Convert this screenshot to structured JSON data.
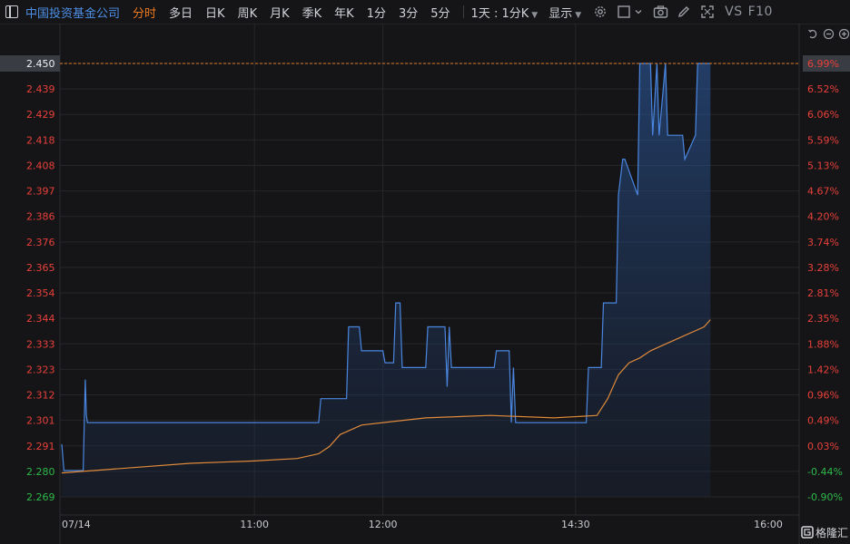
{
  "toolbar": {
    "title": "中国投资基金公司",
    "tabs": [
      {
        "label": "分时",
        "active": true
      },
      {
        "label": "多日",
        "active": false
      },
      {
        "label": "日K",
        "active": false
      },
      {
        "label": "周K",
        "active": false
      },
      {
        "label": "月K",
        "active": false
      },
      {
        "label": "季K",
        "active": false
      },
      {
        "label": "年K",
        "active": false
      },
      {
        "label": "1分",
        "active": false
      },
      {
        "label": "3分",
        "active": false
      },
      {
        "label": "5分",
        "active": false
      }
    ],
    "period_dropdown": "1天 : 1分K",
    "display_dropdown": "显示",
    "vs_label": "VS",
    "f10_label": "F10"
  },
  "colors": {
    "price_line": "#4a86e0",
    "avg_line": "#e08a3a",
    "up": "#e8403a",
    "down": "#2eb84a",
    "neutral": "#e8403a",
    "grid": "#26272b",
    "axis_text": "#9a9da4"
  },
  "chart_data": {
    "type": "line",
    "title": "",
    "current_price_label": "2.450",
    "current_pct_label": "6.99%",
    "y_ticks": [
      {
        "price": "2.450",
        "pct": "6.99%"
      },
      {
        "price": "2.439",
        "pct": "6.52%"
      },
      {
        "price": "2.429",
        "pct": "6.06%"
      },
      {
        "price": "2.418",
        "pct": "5.59%"
      },
      {
        "price": "2.408",
        "pct": "5.13%"
      },
      {
        "price": "2.397",
        "pct": "4.67%"
      },
      {
        "price": "2.386",
        "pct": "4.20%"
      },
      {
        "price": "2.376",
        "pct": "3.74%"
      },
      {
        "price": "2.365",
        "pct": "3.28%"
      },
      {
        "price": "2.354",
        "pct": "2.81%"
      },
      {
        "price": "2.344",
        "pct": "2.35%"
      },
      {
        "price": "2.333",
        "pct": "1.88%"
      },
      {
        "price": "2.323",
        "pct": "1.42%"
      },
      {
        "price": "2.312",
        "pct": "0.96%"
      },
      {
        "price": "2.301",
        "pct": "0.49%"
      },
      {
        "price": "2.291",
        "pct": "0.03%"
      },
      {
        "price": "2.280",
        "pct": "-0.44%"
      },
      {
        "price": "2.269",
        "pct": "-0.90%"
      }
    ],
    "ylim": [
      2.269,
      2.45
    ],
    "prev_close": 2.29,
    "x_labels": [
      "07/14",
      "11:00",
      "12:00",
      "14:30",
      "16:00"
    ],
    "x_label_positions": [
      0,
      90,
      150,
      240,
      330
    ],
    "x_range": [
      0,
      330
    ],
    "series": [
      {
        "name": "",
        "x": [
          0,
          1,
          2,
          10,
          11,
          11.5,
          12,
          120,
          121,
          133,
          134,
          139,
          140,
          150,
          151,
          155,
          156,
          158,
          159,
          170,
          171,
          179,
          180,
          181,
          182,
          202,
          203,
          209,
          210,
          211,
          212,
          216,
          217,
          245,
          246,
          252,
          253,
          259,
          260,
          262,
          263,
          269,
          270,
          275,
          276,
          278,
          279,
          282,
          283,
          290,
          291,
          296,
          297,
          298,
          299,
          301,
          302,
          303
        ],
        "y": [
          2.291,
          2.28,
          2.28,
          2.28,
          2.318,
          2.303,
          2.3,
          2.3,
          2.31,
          2.31,
          2.34,
          2.34,
          2.33,
          2.33,
          2.325,
          2.325,
          2.35,
          2.35,
          2.323,
          2.323,
          2.34,
          2.34,
          2.315,
          2.34,
          2.323,
          2.323,
          2.33,
          2.33,
          2.3,
          2.323,
          2.3,
          2.3,
          2.3,
          2.3,
          2.323,
          2.323,
          2.35,
          2.35,
          2.395,
          2.41,
          2.41,
          2.395,
          2.45,
          2.45,
          2.42,
          2.45,
          2.42,
          2.45,
          2.42,
          2.42,
          2.41,
          2.42,
          2.45,
          2.45,
          2.45,
          2.45,
          2.45,
          2.45
        ]
      },
      {
        "name": "",
        "x": [
          0,
          30,
          60,
          90,
          110,
          120,
          125,
          130,
          135,
          140,
          150,
          170,
          200,
          230,
          250,
          255,
          260,
          265,
          270,
          275,
          280,
          290,
          300,
          303
        ],
        "y": [
          2.279,
          2.281,
          2.283,
          2.284,
          2.285,
          2.287,
          2.29,
          2.295,
          2.297,
          2.299,
          2.3,
          2.302,
          2.303,
          2.302,
          2.303,
          2.31,
          2.32,
          2.325,
          2.327,
          2.33,
          2.332,
          2.336,
          2.34,
          2.343
        ]
      }
    ]
  },
  "watermark": "格隆汇"
}
